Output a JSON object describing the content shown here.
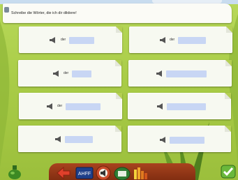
{
  "instruction": {
    "text": "Schreibe die Wörter, die ich dir diktiere!"
  },
  "cards": [
    {
      "article": "der",
      "answer": ""
    },
    {
      "article": "der",
      "answer": ""
    },
    {
      "article": "der",
      "answer": ""
    },
    {
      "article": "",
      "answer": ""
    },
    {
      "article": "der",
      "answer": ""
    },
    {
      "article": "",
      "answer": ""
    },
    {
      "article": "",
      "answer": ""
    },
    {
      "article": "",
      "answer": ""
    }
  ],
  "toolbar": {
    "keyboard_label": "AHFF",
    "icons": [
      "back-arrow-icon",
      "keyboard-icon",
      "speaker-icon",
      "printer-icon",
      "sound-bars-icon",
      "check-icon",
      "bottle-icon"
    ]
  },
  "colors": {
    "background": "#a9cc47",
    "card": "#f7f9f1",
    "answer_field": "#c8d6f4",
    "toolbar": "#9a3a18"
  }
}
